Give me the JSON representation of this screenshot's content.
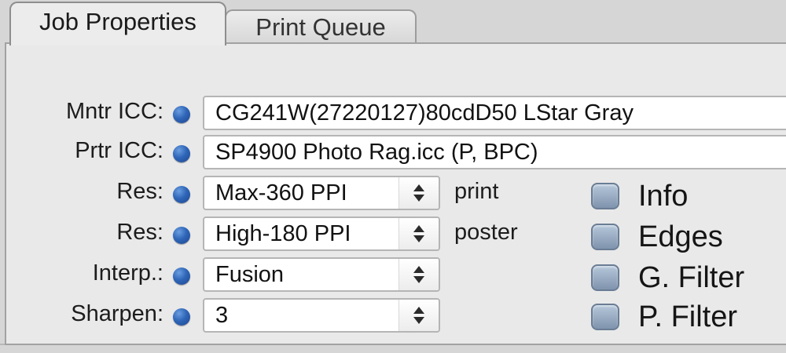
{
  "tabs": [
    {
      "label": "Job Properties",
      "active": true
    },
    {
      "label": "Print Queue",
      "active": false
    }
  ],
  "form": {
    "monitor_icc": {
      "label": "Mntr ICC:",
      "value": "CG241W(27220127)80cdD50 LStar Gray"
    },
    "printer_icc": {
      "label": "Prtr ICC:",
      "value": "SP4900 Photo Rag.icc (P, BPC)"
    },
    "res_print": {
      "label": "Res:",
      "value": "Max-360 PPI",
      "suffix": "print"
    },
    "res_poster": {
      "label": "Res:",
      "value": "High-180 PPI",
      "suffix": "poster"
    },
    "interp": {
      "label": "Interp.:",
      "value": "Fusion"
    },
    "sharpen": {
      "label": "Sharpen:",
      "value": "3"
    }
  },
  "options": [
    {
      "label": "Info",
      "checked": false
    },
    {
      "label": "Edges",
      "checked": false
    },
    {
      "label": "G. Filter",
      "checked": false
    },
    {
      "label": "P. Filter",
      "checked": false
    }
  ],
  "colors": {
    "indicator_blue": "#2f66b8",
    "panel_bg": "#e9e9e9",
    "checkbox_blue_gray": "#8fa3bc"
  },
  "icons": {
    "indicator": "blue-dot-icon",
    "stepper": "up-down-stepper-icon"
  }
}
